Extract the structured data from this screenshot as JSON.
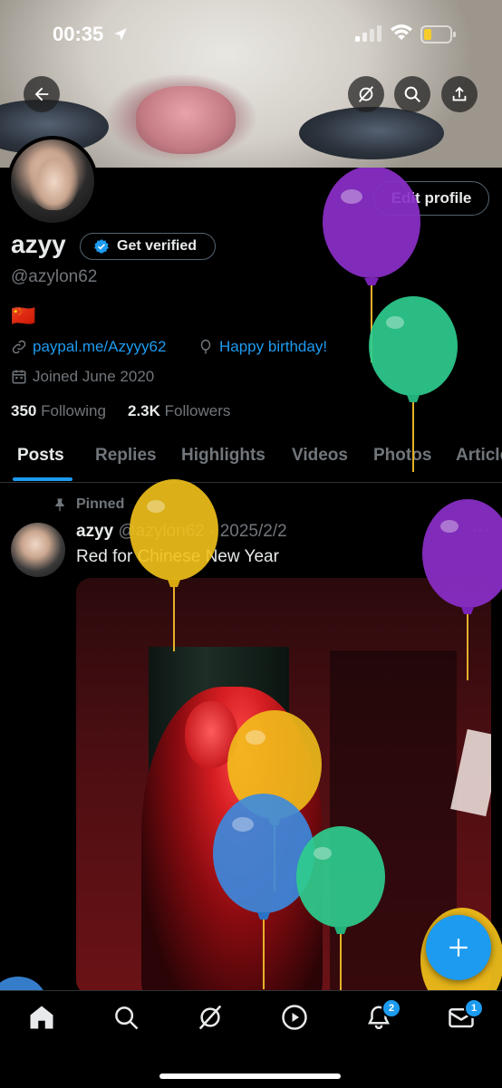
{
  "status_bar": {
    "time": "00:35"
  },
  "profile": {
    "name": "azyy",
    "get_verified_label": "Get verified",
    "handle": "@azylon62",
    "flag": "🇨🇳",
    "link": "paypal.me/Azyyy62",
    "birthday": "Happy birthday!",
    "joined": "Joined June 2020",
    "following_count": "350",
    "following_label": "Following",
    "followers_count": "2.3K",
    "followers_label": "Followers",
    "edit_profile_label": "Edit profile"
  },
  "tabs": [
    "Posts",
    "Replies",
    "Highlights",
    "Videos",
    "Photos",
    "Articles"
  ],
  "post": {
    "pinned_label": "Pinned",
    "author": "azyy",
    "handle": "@azylon62",
    "date": "· 2025/2/2",
    "text": "Red for Chinese New Year",
    "more": "···"
  },
  "nav": {
    "notifications_badge": "2",
    "messages_badge": "1"
  },
  "colors": {
    "accent": "#1d9bf0",
    "balloon_purple": "#8b2fc9",
    "balloon_green": "#2ecc8e",
    "balloon_yellow": "#f2c21b",
    "balloon_blue": "#3b8be0"
  },
  "icons": {
    "back": "back-arrow-icon",
    "grok": "grok-icon",
    "search": "search-icon",
    "share": "share-icon",
    "link": "link-icon",
    "balloon": "balloon-icon",
    "calendar": "calendar-icon",
    "pin": "pin-icon",
    "home": "home-icon",
    "video": "video-icon",
    "bell": "bell-icon",
    "mail": "mail-icon",
    "compose": "plus-icon"
  }
}
